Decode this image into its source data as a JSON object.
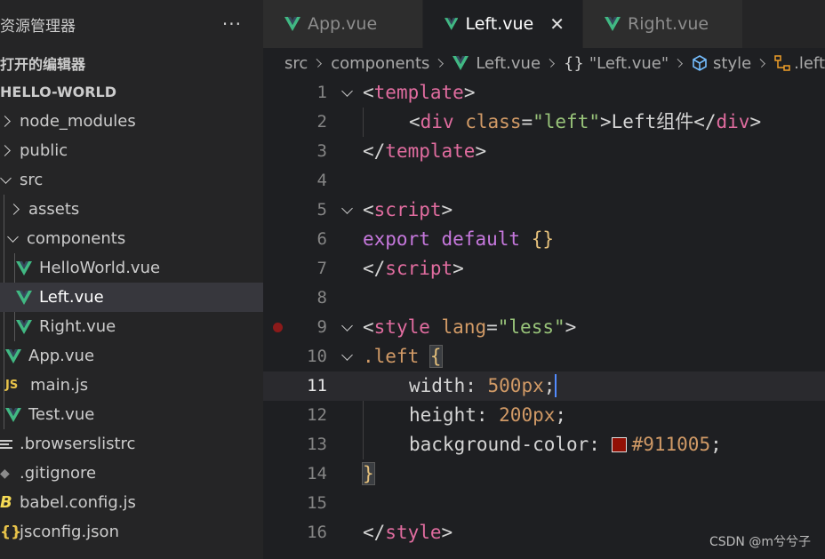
{
  "sidebar": {
    "title": "资源管理器",
    "more": "···",
    "open_editors": "打开的编辑器",
    "project": "HELLO-WORLD",
    "items": [
      {
        "label": "node_modules"
      },
      {
        "label": "public"
      },
      {
        "label": "src"
      },
      {
        "label": "assets"
      },
      {
        "label": "components"
      },
      {
        "label": "HelloWorld.vue"
      },
      {
        "label": "Left.vue"
      },
      {
        "label": "Right.vue"
      },
      {
        "label": "App.vue"
      },
      {
        "label": "main.js",
        "icon_text": "JS"
      },
      {
        "label": "Test.vue"
      },
      {
        "label": ".browserslistrc"
      },
      {
        "label": ".gitignore"
      },
      {
        "label": "babel.config.js",
        "icon_text": "B"
      },
      {
        "label": "jsconfig.json",
        "icon_text": "{}"
      }
    ]
  },
  "tabs": [
    {
      "label": "App.vue"
    },
    {
      "label": "Left.vue",
      "close": "✕"
    },
    {
      "label": "Right.vue"
    }
  ],
  "breadcrumb": {
    "src": "src",
    "components": "components",
    "file": "Left.vue",
    "brace_icon": "{}",
    "section": "\"Left.vue\"",
    "style": "style",
    "selector": ".left"
  },
  "editor": {
    "lines": [
      {
        "n": "1"
      },
      {
        "n": "2"
      },
      {
        "n": "3"
      },
      {
        "n": "4"
      },
      {
        "n": "5"
      },
      {
        "n": "6"
      },
      {
        "n": "7"
      },
      {
        "n": "8"
      },
      {
        "n": "9"
      },
      {
        "n": "10"
      },
      {
        "n": "11"
      },
      {
        "n": "12"
      },
      {
        "n": "13"
      },
      {
        "n": "14"
      },
      {
        "n": "15"
      },
      {
        "n": "16"
      }
    ],
    "tok": {
      "lt": "<",
      "gt": ">",
      "lt_slash": "</",
      "template": "template",
      "div": "div",
      "class_attr": "class",
      "eq": "=",
      "left_str": "\"left\"",
      "left_text": "Left组件",
      "script": "script",
      "export": "export",
      "default": "default",
      "braces": "{}",
      "style": "style",
      "lang_attr": "lang",
      "less_str": "\"less\"",
      "left_sel": ".left",
      "open_brace": "{",
      "close_brace": "}",
      "width_prop": "width",
      "width_val": "500px",
      "height_prop": "height",
      "height_val": "200px",
      "bg_prop": "background-color",
      "bg_val": "#911005",
      "colon": ": ",
      "semi": ";"
    }
  },
  "colors": {
    "swatch": "#911005"
  },
  "watermark": "CSDN @m兮兮子"
}
